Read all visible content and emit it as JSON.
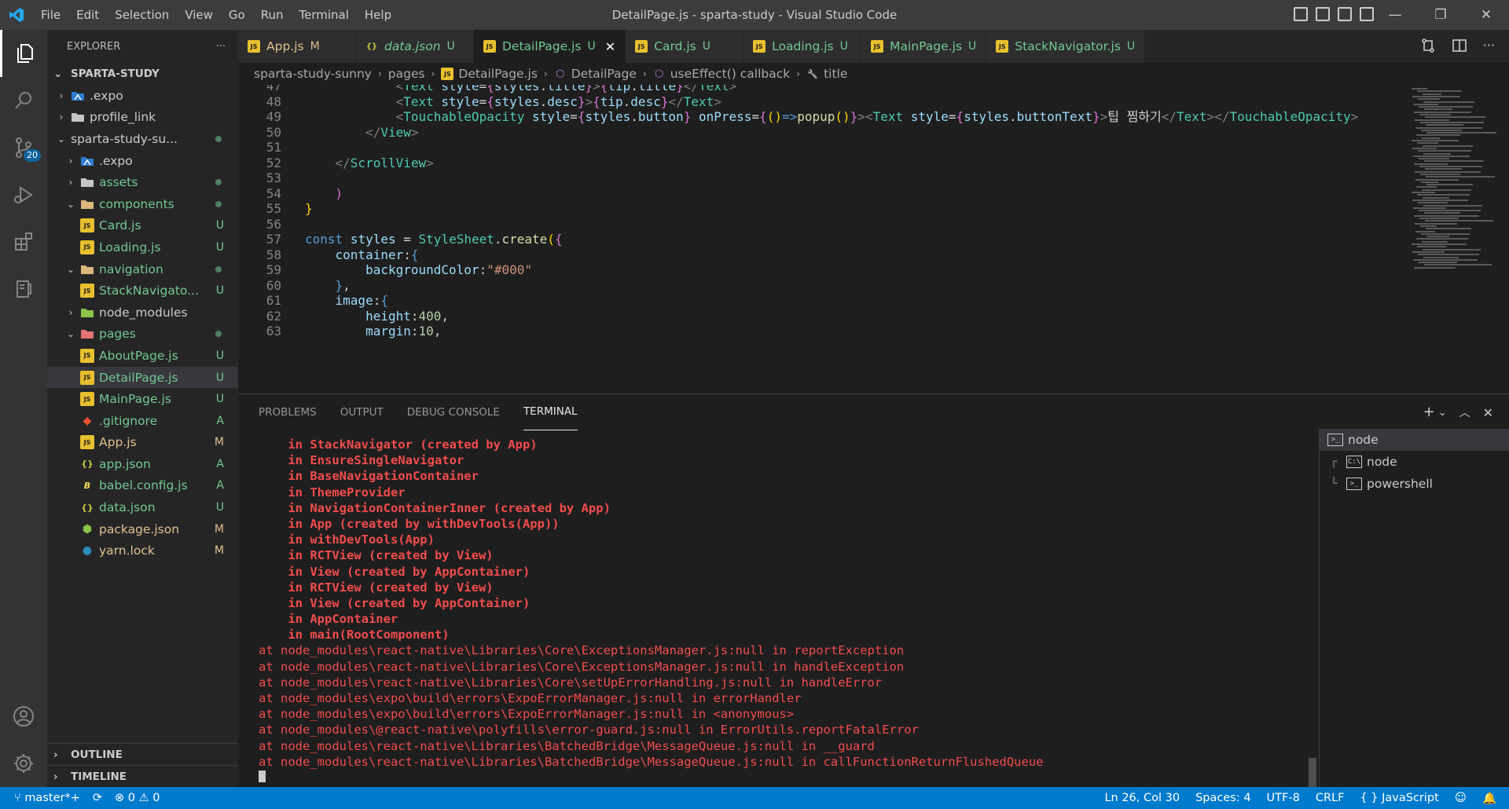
{
  "window": {
    "title": "DetailPage.js - sparta-study - Visual Studio Code",
    "menu": [
      "File",
      "Edit",
      "Selection",
      "View",
      "Go",
      "Run",
      "Terminal",
      "Help"
    ]
  },
  "activity": {
    "scm_badge": "20"
  },
  "sidebar": {
    "header": "EXPLORER",
    "more": "···",
    "root": "SPARTA-STUDY",
    "tree": [
      {
        "label": ".expo",
        "indent": 1,
        "chev": "›",
        "icon": "expo-folder-icon",
        "status": ""
      },
      {
        "label": "profile_link",
        "indent": 1,
        "chev": "›",
        "icon": "folder-icon",
        "status": ""
      },
      {
        "label": "sparta-study-su...",
        "indent": 1,
        "chev": "⌄",
        "icon": "",
        "status": "dot"
      },
      {
        "label": ".expo",
        "indent": 2,
        "chev": "›",
        "icon": "expo-folder-icon",
        "status": ""
      },
      {
        "label": "assets",
        "indent": 2,
        "chev": "›",
        "icon": "folder-icon",
        "status": "dot",
        "color": "u"
      },
      {
        "label": "components",
        "indent": 2,
        "chev": "⌄",
        "icon": "folder-open-icon",
        "status": "dot",
        "color": "u"
      },
      {
        "label": "Card.js",
        "indent": 3,
        "chev": "",
        "icon": "js-icon",
        "status": "U",
        "color": "u"
      },
      {
        "label": "Loading.js",
        "indent": 3,
        "chev": "",
        "icon": "js-icon",
        "status": "U",
        "color": "u"
      },
      {
        "label": "navigation",
        "indent": 2,
        "chev": "⌄",
        "icon": "folder-open-icon",
        "status": "dot",
        "color": "u"
      },
      {
        "label": "StackNavigato...",
        "indent": 3,
        "chev": "",
        "icon": "js-icon",
        "status": "U",
        "color": "u"
      },
      {
        "label": "node_modules",
        "indent": 2,
        "chev": "›",
        "icon": "node-folder-icon",
        "status": ""
      },
      {
        "label": "pages",
        "indent": 2,
        "chev": "⌄",
        "icon": "pages-folder-icon",
        "status": "dot",
        "color": "u"
      },
      {
        "label": "AboutPage.js",
        "indent": 3,
        "chev": "",
        "icon": "js-icon",
        "status": "U",
        "color": "u"
      },
      {
        "label": "DetailPage.js",
        "indent": 3,
        "chev": "",
        "icon": "js-icon",
        "status": "U",
        "color": "u",
        "selected": true
      },
      {
        "label": "MainPage.js",
        "indent": 3,
        "chev": "",
        "icon": "js-icon",
        "status": "U",
        "color": "u"
      },
      {
        "label": ".gitignore",
        "indent": 2,
        "chev": "",
        "icon": "git-icon",
        "status": "A",
        "color": "u"
      },
      {
        "label": "App.js",
        "indent": 2,
        "chev": "",
        "icon": "js-icon",
        "status": "M",
        "color": "m"
      },
      {
        "label": "app.json",
        "indent": 2,
        "chev": "",
        "icon": "json-icon",
        "status": "A",
        "color": "u"
      },
      {
        "label": "babel.config.js",
        "indent": 2,
        "chev": "",
        "icon": "babel-icon",
        "status": "A",
        "color": "u"
      },
      {
        "label": "data.json",
        "indent": 2,
        "chev": "",
        "icon": "json-icon",
        "status": "U",
        "color": "u"
      },
      {
        "label": "package.json",
        "indent": 2,
        "chev": "",
        "icon": "npm-icon",
        "status": "M",
        "color": "m"
      },
      {
        "label": "yarn.lock",
        "indent": 2,
        "chev": "",
        "icon": "yarn-icon",
        "status": "M",
        "color": "m"
      }
    ],
    "outline": "OUTLINE",
    "timeline": "TIMELINE"
  },
  "tabs": [
    {
      "label": "App.js",
      "status": "M",
      "icon": "js-icon",
      "color": "m"
    },
    {
      "label": "data.json",
      "status": "U",
      "icon": "json-icon",
      "color": "u",
      "italic": true
    },
    {
      "label": "DetailPage.js",
      "status": "U",
      "icon": "js-icon",
      "color": "u",
      "active": true
    },
    {
      "label": "Card.js",
      "status": "U",
      "icon": "js-icon",
      "color": "u"
    },
    {
      "label": "Loading.js",
      "status": "U",
      "icon": "js-icon",
      "color": "u"
    },
    {
      "label": "MainPage.js",
      "status": "U",
      "icon": "js-icon",
      "color": "u"
    },
    {
      "label": "StackNavigator.js",
      "status": "U",
      "icon": "js-icon",
      "color": "u"
    }
  ],
  "breadcrumb": [
    "sparta-study-sunny",
    "pages",
    "DetailPage.js",
    "DetailPage",
    "useEffect() callback",
    "title"
  ],
  "editor": {
    "lines": [
      {
        "n": "47",
        "html": "            <span class='t-br'>&lt;</span><span class='t-tag'>Text</span> <span class='t-attr'>style</span><span class='t-txt'>=</span><span class='t-brace'>{</span><span class='t-var'>styles</span><span class='t-txt'>.</span><span class='t-var'>title</span><span class='t-brace'>}</span><span class='t-br'>&gt;</span><span class='t-brace'>{</span><span class='t-var'>tip</span><span class='t-txt'>.</span><span class='t-var'>title</span><span class='t-brace'>}</span><span class='t-br'>&lt;/</span><span class='t-tag'>Text</span><span class='t-br'>&gt;</span>"
      },
      {
        "n": "48",
        "html": "            <span class='t-br'>&lt;</span><span class='t-tag'>Text</span> <span class='t-attr'>style</span><span class='t-txt'>=</span><span class='t-brace'>{</span><span class='t-var'>styles</span><span class='t-txt'>.</span><span class='t-var'>desc</span><span class='t-brace'>}</span><span class='t-br'>&gt;</span><span class='t-brace'>{</span><span class='t-var'>tip</span><span class='t-txt'>.</span><span class='t-var'>desc</span><span class='t-brace'>}</span><span class='t-br'>&lt;/</span><span class='t-tag'>Text</span><span class='t-br'>&gt;</span>"
      },
      {
        "n": "49",
        "html": "            <span class='t-br'>&lt;</span><span class='t-tag'>TouchableOpacity</span> <span class='t-attr'>style</span><span class='t-txt'>=</span><span class='t-brace'>{</span><span class='t-var'>styles</span><span class='t-txt'>.</span><span class='t-var'>button</span><span class='t-brace'>}</span> <span class='t-attr'>onPress</span><span class='t-txt'>=</span><span class='t-brace'>{</span><span class='t-brace2'>()</span><span class='t-kw'>=&gt;</span><span class='t-fn'>popup</span><span class='t-brace2'>()</span><span class='t-brace'>}</span><span class='t-br'>&gt;&lt;</span><span class='t-tag'>Text</span> <span class='t-attr'>style</span><span class='t-txt'>=</span><span class='t-brace'>{</span><span class='t-var'>styles</span><span class='t-txt'>.</span><span class='t-var'>buttonText</span><span class='t-brace'>}</span><span class='t-br'>&gt;</span><span class='t-txt'>팁 찜하기</span><span class='t-br'>&lt;/</span><span class='t-tag'>Text</span><span class='t-br'>&gt;&lt;/</span><span class='t-tag'>TouchableOpacity</span><span class='t-br'>&gt;</span>"
      },
      {
        "n": "50",
        "html": "        <span class='t-br'>&lt;/</span><span class='t-tag'>View</span><span class='t-br'>&gt;</span>"
      },
      {
        "n": "51",
        "html": ""
      },
      {
        "n": "52",
        "html": "    <span class='t-br'>&lt;/</span><span class='t-tag'>ScrollView</span><span class='t-br'>&gt;</span>"
      },
      {
        "n": "53",
        "html": ""
      },
      {
        "n": "54",
        "html": "    <span class='t-brace'>)</span>"
      },
      {
        "n": "55",
        "html": "<span class='t-brace2'>}</span>"
      },
      {
        "n": "56",
        "html": ""
      },
      {
        "n": "57",
        "html": "<span class='t-kw'>const</span> <span class='t-var'>styles</span> <span class='t-txt'>=</span> <span class='t-cls'>StyleSheet</span><span class='t-txt'>.</span><span class='t-fn'>create</span><span class='t-brace2'>(</span><span class='t-brace'>{</span>"
      },
      {
        "n": "58",
        "html": "    <span class='t-var'>container</span><span class='t-txt'>:</span><span class='t-kw'>{</span>"
      },
      {
        "n": "59",
        "html": "        <span class='t-var'>backgroundColor</span><span class='t-txt'>:</span><span class='t-str'>\"#000\"</span>"
      },
      {
        "n": "60",
        "html": "    <span class='t-kw'>}</span><span class='t-txt'>,</span>"
      },
      {
        "n": "61",
        "html": "    <span class='t-var'>image</span><span class='t-txt'>:</span><span class='t-kw'>{</span>"
      },
      {
        "n": "62",
        "html": "        <span class='t-var'>height</span><span class='t-txt'>:</span><span class='t-num'>400</span><span class='t-txt'>,</span>"
      },
      {
        "n": "63",
        "html": "        <span class='t-var'>margin</span><span class='t-txt'>:</span><span class='t-num'>10</span><span class='t-txt'>,</span>"
      }
    ]
  },
  "panel": {
    "tabs": [
      "PROBLEMS",
      "OUTPUT",
      "DEBUG CONSOLE",
      "TERMINAL"
    ],
    "active_tab": "TERMINAL",
    "terminal_lines": [
      {
        "t": "    in StackNavigator (created by App)",
        "k": "err"
      },
      {
        "t": "    in EnsureSingleNavigator",
        "k": "err"
      },
      {
        "t": "    in BaseNavigationContainer",
        "k": "err"
      },
      {
        "t": "    in ThemeProvider",
        "k": "err"
      },
      {
        "t": "    in NavigationContainerInner (created by App)",
        "k": "err"
      },
      {
        "t": "    in App (created by withDevTools(App))",
        "k": "err"
      },
      {
        "t": "    in withDevTools(App)",
        "k": "err"
      },
      {
        "t": "    in RCTView (created by View)",
        "k": "err"
      },
      {
        "t": "    in View (created by AppContainer)",
        "k": "err"
      },
      {
        "t": "    in RCTView (created by View)",
        "k": "err"
      },
      {
        "t": "    in View (created by AppContainer)",
        "k": "err"
      },
      {
        "t": "    in AppContainer",
        "k": "err"
      },
      {
        "t": "    in main(RootComponent)",
        "k": "err"
      },
      {
        "t": "at node_modules\\react-native\\Libraries\\Core\\ExceptionsManager.js:null in reportException",
        "k": "at"
      },
      {
        "t": "at node_modules\\react-native\\Libraries\\Core\\ExceptionsManager.js:null in handleException",
        "k": "at"
      },
      {
        "t": "at node_modules\\react-native\\Libraries\\Core\\setUpErrorHandling.js:null in handleError",
        "k": "at"
      },
      {
        "t": "at node_modules\\expo\\build\\errors\\ExpoErrorManager.js:null in errorHandler",
        "k": "at"
      },
      {
        "t": "at node_modules\\expo\\build\\errors\\ExpoErrorManager.js:null in <anonymous>",
        "k": "at"
      },
      {
        "t": "at node_modules\\@react-native\\polyfills\\error-guard.js:null in ErrorUtils.reportFatalError",
        "k": "at"
      },
      {
        "t": "at node_modules\\react-native\\Libraries\\BatchedBridge\\MessageQueue.js:null in __guard",
        "k": "at"
      },
      {
        "t": "at node_modules\\react-native\\Libraries\\BatchedBridge\\MessageQueue.js:null in callFunctionReturnFlushedQueue",
        "k": "at"
      }
    ],
    "terminals": [
      {
        "label": "node",
        "tree": "",
        "active": true
      },
      {
        "label": "node",
        "tree": "┌"
      },
      {
        "label": "powershell",
        "tree": "└"
      }
    ]
  },
  "statusbar": {
    "branch": "master*+",
    "errors": "0",
    "warnings": "0",
    "position": "Ln 26, Col 30",
    "spaces": "Spaces: 4",
    "encoding": "UTF-8",
    "eol": "CRLF",
    "language": "JavaScript"
  },
  "colors": {
    "accent": "#007acc",
    "untracked": "#73c991",
    "modified": "#e2c08d",
    "error": "#f14c4c"
  }
}
